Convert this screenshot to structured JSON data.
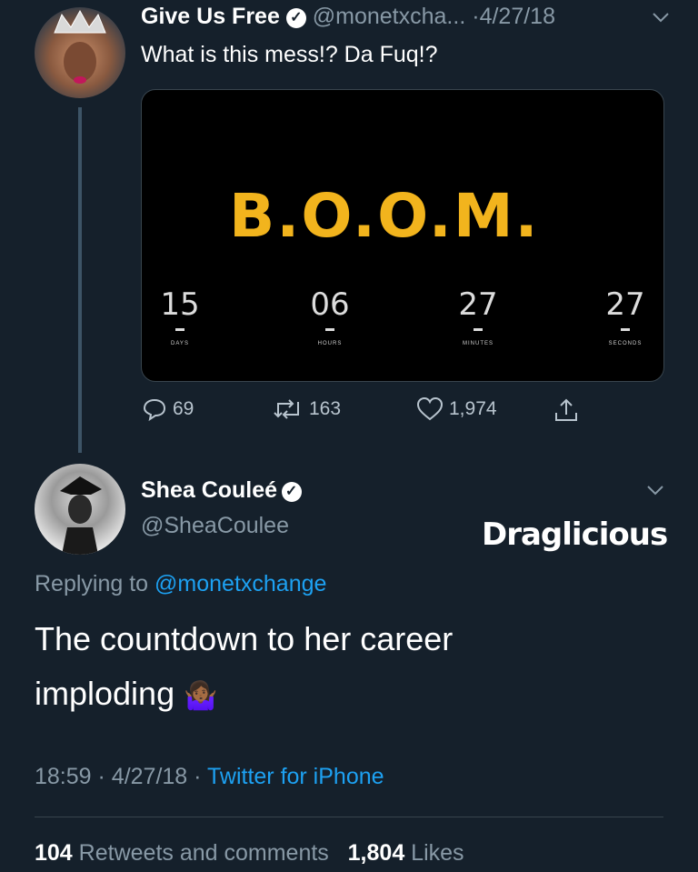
{
  "tweet1": {
    "display_name": "Give Us Free",
    "handle": "@monetxcha...",
    "separator": "·",
    "date": "4/27/18",
    "text": "What is this mess!? Da Fuq!?",
    "media": {
      "title": "B.O.O.M.",
      "countdown": [
        {
          "value": "15",
          "label": "DAYS"
        },
        {
          "value": "06",
          "label": "HOURS"
        },
        {
          "value": "27",
          "label": "MINUTES"
        },
        {
          "value": "27",
          "label": "SECONDS"
        }
      ]
    },
    "actions": {
      "replies": "69",
      "retweets": "163",
      "likes": "1,974"
    },
    "colors": {
      "accent": "#f2b41d",
      "media_bg": "#000000"
    }
  },
  "tweet2": {
    "display_name": "Shea Couleé",
    "handle": "@SheaCoulee",
    "replying_prefix": "Replying to",
    "replying_handle": "@monetxchange",
    "text_line1": "The countdown to her career",
    "text_line2": "imploding",
    "emoji": "🤷🏾‍♀️",
    "time": "18:59",
    "date": "4/27/18",
    "separator": "·",
    "source": "Twitter for iPhone",
    "stats": {
      "retweets_count": "104",
      "retweets_label": "Retweets and comments",
      "likes_count": "1,804",
      "likes_label": "Likes"
    }
  },
  "watermark": "Draglicious",
  "icons": {
    "verified": "verified-badge-icon",
    "chevron": "chevron-down-icon",
    "reply": "reply-icon",
    "retweet": "retweet-icon",
    "like": "heart-icon",
    "share": "share-icon"
  },
  "colors": {
    "background": "#15202b",
    "link": "#1da1f2",
    "muted": "#8899a6"
  }
}
